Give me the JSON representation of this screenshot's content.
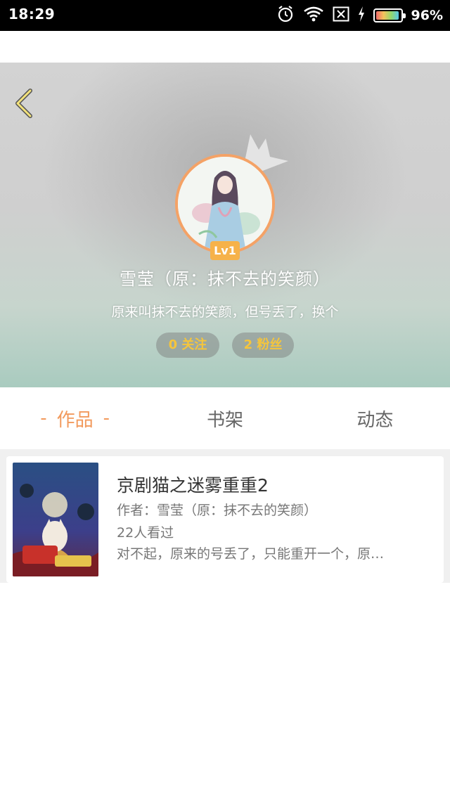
{
  "status_bar": {
    "time": "18:29",
    "battery": "96%",
    "battery_level": 0.96,
    "icons": [
      "alarm-icon",
      "wifi-icon",
      "sim-icon",
      "charging-icon",
      "battery-icon"
    ]
  },
  "profile": {
    "level": "Lv1",
    "name": "雪莹（原：抹不去的笑颜）",
    "bio": "原来叫抹不去的笑颜，但号丢了，换个",
    "follow_label": "0 关注",
    "fans_label": "2 粉丝",
    "accent_color": "#f4a266"
  },
  "tabs": [
    {
      "label": "作品",
      "active": true
    },
    {
      "label": "书架",
      "active": false
    },
    {
      "label": "动态",
      "active": false
    }
  ],
  "tab_dash": "-",
  "works": [
    {
      "title": "京剧猫之迷雾重重2",
      "author": "作者：雪莹（原：抹不去的笑颜）",
      "views": "22人看过",
      "description": "对不起，原来的号丢了，只能重开一个，原…"
    }
  ]
}
